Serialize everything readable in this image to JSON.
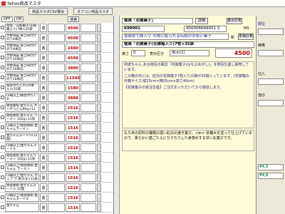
{
  "window": {
    "title": "Yahoo商品マスタ"
  },
  "toolbar": {
    "csv_label": "商品マスタCSV書出",
    "other_label": "オフコン商品マスタ"
  },
  "list": {
    "off_label": "OFF",
    "on_label": "ON",
    "search_label": "検索",
    "items": [
      {
        "name": "徳島「花嫁菓子(花嫁箱入り)7枚×35袋",
        "kind": "書",
        "price": "4500"
      },
      {
        "name": "大野海苔 卓上味付けのり8本詰",
        "kind": "書",
        "price": "4500"
      },
      {
        "name": "大野海苔 卓上味付けのり8本詰",
        "kind": "書",
        "price": "2480"
      },
      {
        "name": "大野海苔 卓上味付けのり16本詰",
        "kind": "書",
        "price": "4500"
      },
      {
        "name": "大野海苔 卓上味付けのり16本詰",
        "kind": "書",
        "price": "3880"
      },
      {
        "name": "大野海苔 卓上味付けのり18本詰",
        "kind": "書",
        "price": "11340"
      },
      {
        "name": "徳島竹ちくわ(20本入)×10袋",
        "kind": "書",
        "price": "1580"
      },
      {
        "name": "(2箱以上)徳島竹ちくわ",
        "kind": "書",
        "price": "3888"
      },
      {
        "name": "徳島製粉 金ちゃん キンギうどん90g×12袋",
        "kind": "書",
        "price": "1516"
      },
      {
        "name": "徳島製粉 金ちゃん ラーメン 102g×12食",
        "kind": "書",
        "price": "1516"
      },
      {
        "name": "(2箱以上)徳島製粉 金ちゃんラーメン",
        "kind": "書",
        "price": "1516"
      },
      {
        "name": "金ちゃんヌードル(12個)",
        "kind": "書",
        "price": "1516"
      },
      {
        "name": "(2箱以上)金ちゃんヌードル",
        "kind": "書",
        "price": "1516"
      },
      {
        "name": "徳島製粉 金ちゃんラーメン 102g×12食",
        "kind": "書",
        "price": "1516"
      },
      {
        "name": "(2箱以上)徳島製粉 金ちゃん ラーメン 102g×12食",
        "kind": "書",
        "price": "1516"
      },
      {
        "name": "(2箱以上)金ちゃん カップ 汁 焼そば×12食",
        "kind": "書",
        "price": "1516"
      },
      {
        "name": "徳島製粉 金ちゃんヌードル 12個",
        "kind": "書",
        "price": "1516"
      },
      {
        "name": "(2箱以上)徳島製粉 金ちゃんヌードル",
        "kind": "書",
        "price": "1516"
      },
      {
        "name": "金ちゃん",
        "kind": "書",
        "price": "1516"
      }
    ]
  },
  "detail": {
    "title": "徳島「花嫁菓子」",
    "detail_btn": "詳細",
    "export_btn": "書出対象",
    "code1": "699001",
    "code2": "400006699001 3",
    "catch": "徳島県で嫁入り の際に配られる伝統のお祝い菓子",
    "name_full": "徳島「花嫁菓子(花嫁箱入り)7枚×35袋",
    "oku_label": "奥さ",
    "oku_value": "0",
    "disp_label": "表示区分",
    "disp_value": "表示(1)",
    "price": "4500",
    "desc1": "阿波ちゃん ある徳島の風習「花嫁菓子(はなよめがし)」を徳島生産し販売しています。",
    "desc2": "この箱の中には、紅白の花嫁菓子7枚入りの袋が35袋入っています。(花嫁箱の外箱サイズ:縦25cm×横25cm×高さ40cm)",
    "desc3": "【花嫁菓子の受注生産】ご注文をいただいてから製造します。",
    "desc4": "もち米の原料の種類の濃い紅白の焼き菓子。<br> 砂糖水を塗って仕上げているので、柔らかい歯ごたえにちりちりした食感がする甘いお菓子です。",
    "new_label": "新",
    "unit_btn": "単価計算",
    "ms_label": "MS"
  },
  "right": {
    "seq_label": "順位",
    "price_label": "価格",
    "buy_label": "仕入",
    "extra_label": "他の",
    "price2": "¥4,5",
    "price3": "¥4,0"
  },
  "colors": {
    "price_red": "#c00000",
    "detail_bg": "#fffbd8",
    "accent_green": "#2e8b57"
  }
}
